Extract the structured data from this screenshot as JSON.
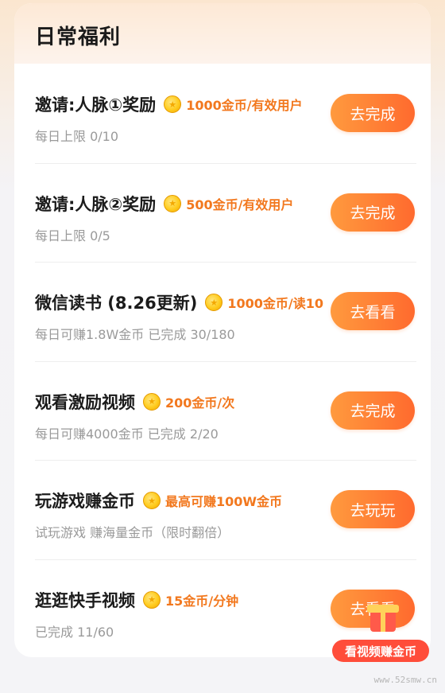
{
  "section": {
    "title": "日常福利"
  },
  "tasks": [
    {
      "title": "邀请:人脉①奖励",
      "reward": "1000金币/有效用户",
      "subtitle": "每日上限 0/10",
      "button": "去完成"
    },
    {
      "title": "邀请:人脉②奖励",
      "reward": "500金币/有效用户",
      "subtitle": "每日上限 0/5",
      "button": "去完成"
    },
    {
      "title": "微信读书 (8.26更新)",
      "reward": "1000金币/读10",
      "subtitle": "每日可赚1.8W金币  已完成 30/180",
      "button": "去看看"
    },
    {
      "title": "观看激励视频",
      "reward": "200金币/次",
      "subtitle": "每日可赚4000金币 已完成 2/20",
      "button": "去完成"
    },
    {
      "title": "玩游戏赚金币",
      "reward": "最高可赚100W金币",
      "subtitle": "试玩游戏 赚海量金币（限时翻倍）",
      "button": "去玩玩"
    },
    {
      "title": "逛逛快手视频",
      "reward": "15金币/分钟",
      "subtitle": "已完成 11/60",
      "button": "去看看"
    }
  ],
  "promo": {
    "label": "看视频赚金币",
    "icon": "gift-icon"
  },
  "watermark": "www.52smw.cn",
  "colors": {
    "accent": "#ff7a2e",
    "reward": "#f2781e",
    "coin": "#ffcc1f"
  }
}
